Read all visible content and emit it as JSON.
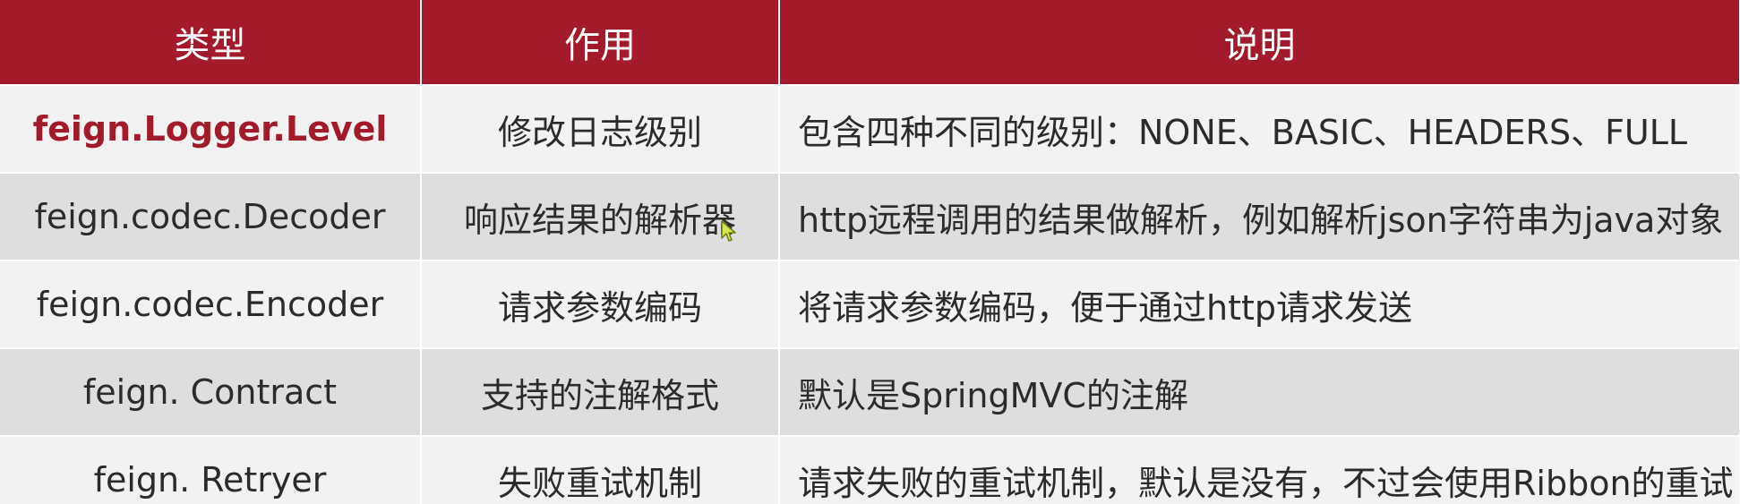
{
  "table": {
    "headers": [
      "类型",
      "作用",
      "说明"
    ],
    "rows": [
      {
        "type": "feign.Logger.Level",
        "purpose": "修改日志级别",
        "description": "包含四种不同的级别：NONE、BASIC、HEADERS、FULL",
        "highlight": true
      },
      {
        "type": "feign.codec.Decoder",
        "purpose": "响应结果的解析器",
        "description": "http远程调用的结果做解析，例如解析json字符串为java对象",
        "highlight": false
      },
      {
        "type": "feign.codec.Encoder",
        "purpose": "请求参数编码",
        "description": "将请求参数编码，便于通过http请求发送",
        "highlight": false
      },
      {
        "type": "feign. Contract",
        "purpose": "支持的注解格式",
        "description": "默认是SpringMVC的注解",
        "highlight": false
      },
      {
        "type": "feign. Retryer",
        "purpose": "失败重试机制",
        "description": "请求失败的重试机制，默认是没有，不过会使用Ribbon的重试",
        "highlight": false
      }
    ]
  },
  "colors": {
    "header_bg": "#a31b2a",
    "header_text": "#ffffff",
    "highlight_text": "#a31b2a",
    "row_light": "#f2f2f2",
    "row_dark": "#dedede"
  },
  "cursor_icon": "mouse-pointer-icon"
}
